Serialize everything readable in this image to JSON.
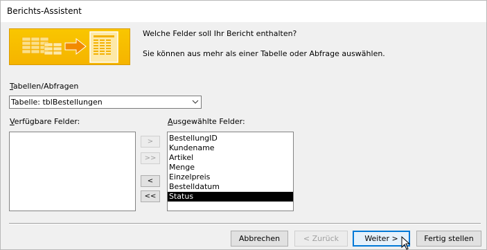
{
  "window": {
    "title": "Berichts-Assistent"
  },
  "intro": {
    "question": "Welche Felder soll Ihr Bericht enthalten?",
    "hint": "Sie können aus mehr als einer Tabelle oder Abfrage auswählen."
  },
  "source": {
    "label_accel": "T",
    "label_rest": "abellen/Abfragen",
    "selected": "Tabelle: tblBestellungen"
  },
  "available": {
    "label_accel": "V",
    "label_rest": "erfügbare Felder:",
    "items": []
  },
  "selected_fields": {
    "label_accel": "A",
    "label_rest": "usgewählte Felder:",
    "items": [
      "BestellungID",
      "Kundename",
      "Artikel",
      "Menge",
      "Einzelpreis",
      "Bestelldatum",
      "Status"
    ],
    "highlighted": "Status"
  },
  "move_buttons": {
    "add": ">",
    "add_all": ">>",
    "remove": "<",
    "remove_all": "<<"
  },
  "footer": {
    "cancel": "Abbrechen",
    "back": "< Zurück",
    "next": "Weiter >",
    "finish": "Fertig stellen"
  },
  "colors": {
    "banner": "#f5b400",
    "default_button_border": "#0078d7"
  }
}
